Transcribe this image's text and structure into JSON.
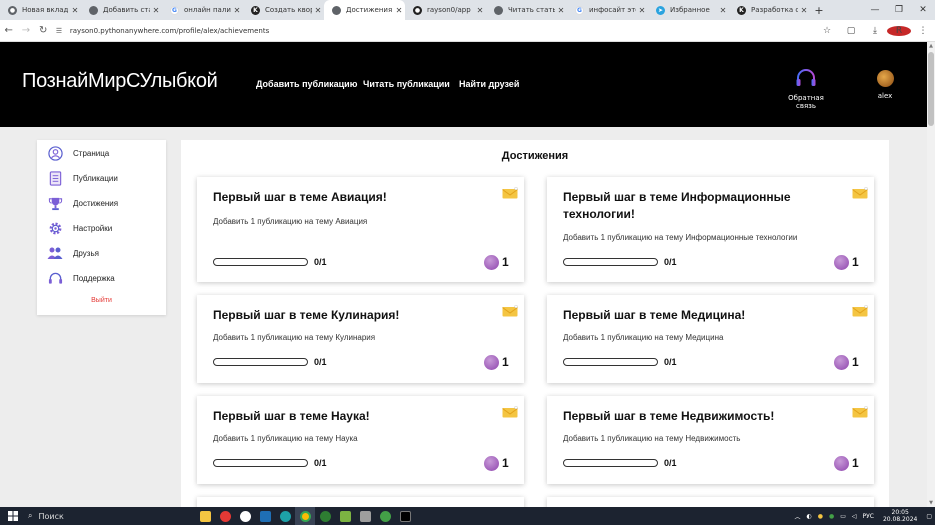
{
  "browser": {
    "tabs": [
      {
        "title": "Новая вкладка",
        "icon": "chrome-icon",
        "color": "#5f6368"
      },
      {
        "title": "Добавить статью",
        "icon": "site-icon",
        "color": "#5f6368"
      },
      {
        "title": "онлайн палитра",
        "icon": "google-icon",
        "color": "#4285f4"
      },
      {
        "title": "Создать кворк - ",
        "icon": "kwork-icon",
        "color": "#222"
      },
      {
        "title": "Достижения",
        "icon": "site-icon",
        "color": "#5f6368",
        "active": true
      },
      {
        "title": "rayson0/app",
        "icon": "github-icon",
        "color": "#222"
      },
      {
        "title": "Читать статьи",
        "icon": "site-icon",
        "color": "#5f6368"
      },
      {
        "title": "инфосайт это - П",
        "icon": "google-icon",
        "color": "#4285f4"
      },
      {
        "title": "Избранное",
        "icon": "telegram-icon",
        "color": "#2aa3df"
      },
      {
        "title": "Разработка сайт",
        "icon": "kwork-icon",
        "color": "#222"
      }
    ],
    "url": "rayson0.pythonanywhere.com/profile/alex/achievements"
  },
  "header": {
    "logo": "ПознайМирСУлыбкой",
    "nav": [
      "Добавить публикацию",
      "Читать публикации",
      "Найти друзей"
    ],
    "support_label": "Обратная связь",
    "user_name": "alex"
  },
  "sidebar": {
    "items": [
      {
        "label": "Страница",
        "icon": "user-icon"
      },
      {
        "label": "Публикации",
        "icon": "document-icon"
      },
      {
        "label": "Достижения",
        "icon": "trophy-icon"
      },
      {
        "label": "Настройки",
        "icon": "gear-icon"
      },
      {
        "label": "Друзья",
        "icon": "friends-icon"
      },
      {
        "label": "Поддержка",
        "icon": "headset-icon"
      }
    ],
    "logout": "Выйти"
  },
  "main": {
    "title": "Достижения",
    "cards": [
      {
        "title": "Первый шаг в теме Авиация!",
        "desc": "Добавить 1 публикацию на тему Авиация",
        "progress": "0/1",
        "progress_fraction": 0,
        "points": "1"
      },
      {
        "title": "Первый шаг в теме Информационные технологии!",
        "desc": "Добавить 1 публикацию на тему Информационные технологии",
        "progress": "0/1",
        "progress_fraction": 0,
        "points": "1"
      },
      {
        "title": "Первый шаг в теме Кулинария!",
        "desc": "Добавить 1 публикацию на тему Кулинария",
        "progress": "0/1",
        "progress_fraction": 0,
        "points": "1"
      },
      {
        "title": "Первый шаг в теме Медицина!",
        "desc": "Добавить 1 публикацию на тему Медицина",
        "progress": "0/1",
        "progress_fraction": 0,
        "points": "1"
      },
      {
        "title": "Первый шаг в теме Наука!",
        "desc": "Добавить 1 публикацию на тему Наука",
        "progress": "0/1",
        "progress_fraction": 0,
        "points": "1"
      },
      {
        "title": "Первый шаг в теме Недвижимость!",
        "desc": "Добавить 1 публикацию на тему Недвижимость",
        "progress": "0/1",
        "progress_fraction": 0,
        "points": "1"
      }
    ]
  },
  "taskbar": {
    "search": "Поиск",
    "lang": "РУС",
    "time": "20:05",
    "date": "20.08.2024"
  }
}
